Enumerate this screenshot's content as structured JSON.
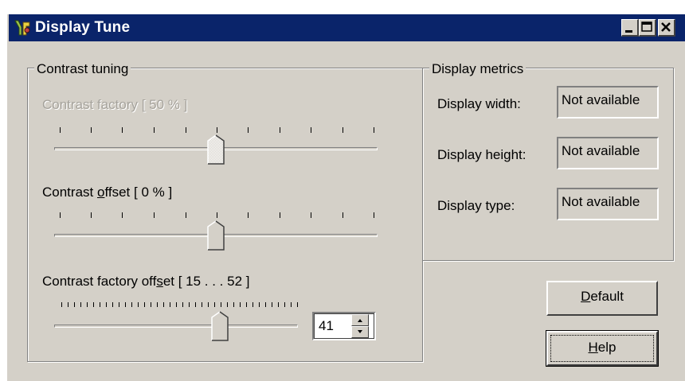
{
  "window": {
    "title": "Display Tune",
    "icon": "display-tune-app-icon",
    "controls": [
      "minimize-icon",
      "maximize-icon",
      "close-icon"
    ]
  },
  "contrast_tuning": {
    "group_label": "Contrast tuning",
    "factory": {
      "label": "Contrast factory [ 50 % ]",
      "enabled": false,
      "value_percent": 50
    },
    "offset": {
      "label_pre": "Contrast ",
      "label_mnemonic": "o",
      "label_post": "ffset [  0 % ]",
      "value_percent": 0
    },
    "factory_offset": {
      "label_pre": "Contrast factory off",
      "label_mnemonic": "s",
      "label_post": "et [ 15 . . . 52 ]",
      "min": 15,
      "max": 52,
      "value": 41,
      "spin_value": "41"
    }
  },
  "display_metrics": {
    "group_label": "Display metrics",
    "rows": [
      {
        "label": "Display width:",
        "value": "Not available"
      },
      {
        "label": "Display height:",
        "value": "Not available"
      },
      {
        "label": "Display type:",
        "value": "Not available"
      }
    ]
  },
  "buttons": {
    "default_mnemonic": "D",
    "default_rest": "efault",
    "help_mnemonic": "H",
    "help_rest": "elp"
  },
  "colors": {
    "titlebar": "#0a246a",
    "face": "#d4d0c8"
  }
}
